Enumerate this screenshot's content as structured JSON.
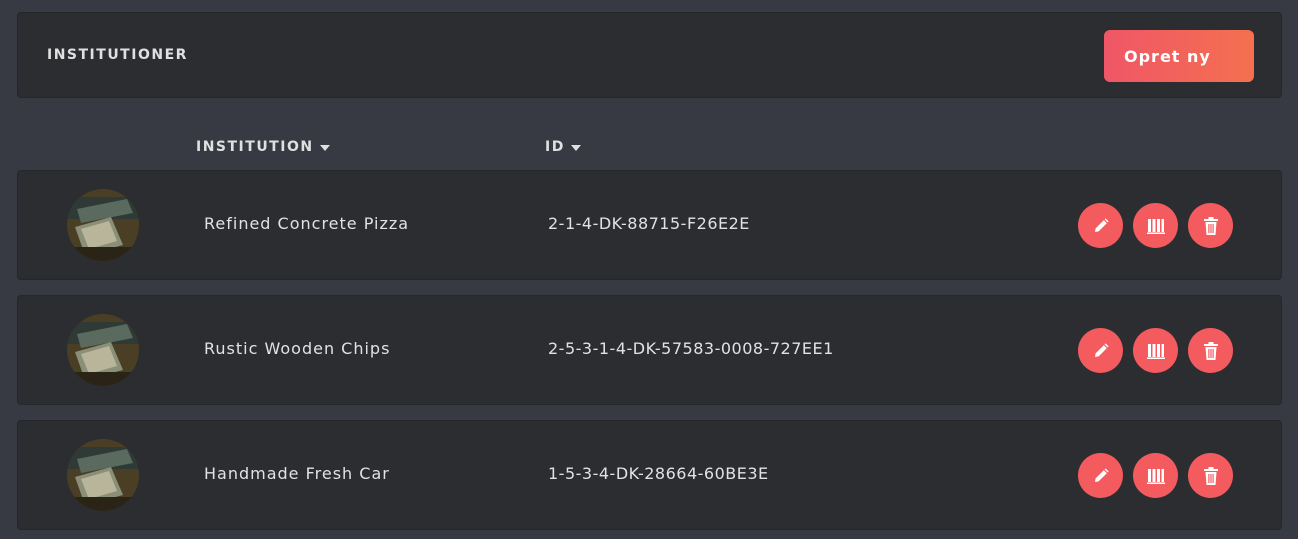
{
  "header": {
    "title": "INSTITUTIONER",
    "create_label": "Opret ny"
  },
  "columns": {
    "institution": "INSTITUTION",
    "id": "ID"
  },
  "colors": {
    "accent": "#f45b5f",
    "background": "#373a43",
    "card": "#2c2d31"
  },
  "rows": [
    {
      "name": "Refined Concrete Pizza",
      "id": "2-1-4-DK-88715-F26E2E"
    },
    {
      "name": "Rustic Wooden Chips",
      "id": "2-5-3-1-4-DK-57583-0008-727EE1"
    },
    {
      "name": "Handmade Fresh Car",
      "id": "1-5-3-4-DK-28664-60BE3E"
    }
  ],
  "icons": {
    "edit": "pencil-icon",
    "library": "books-icon",
    "delete": "trash-icon",
    "sort": "caret-down-icon"
  }
}
